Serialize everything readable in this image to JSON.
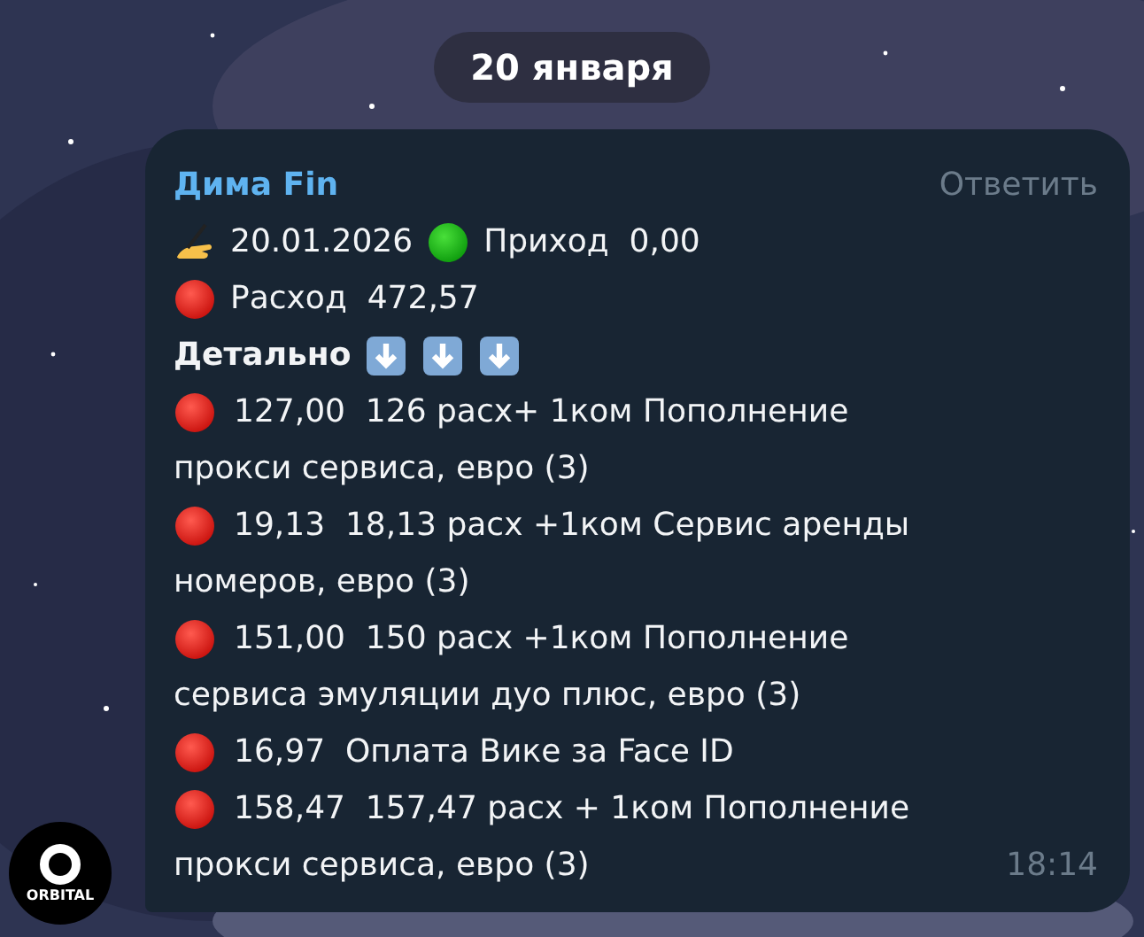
{
  "date_pill": "20 января",
  "message": {
    "sender": "Дима Fin",
    "reply": "Ответить",
    "time": "18:14",
    "summary": [
      [
        {
          "kind": "writing-hand"
        },
        {
          "kind": "text",
          "text": "20.01.2026"
        },
        {
          "kind": "green-dot"
        },
        {
          "kind": "text",
          "text": "Приход  0,00"
        }
      ],
      [
        {
          "kind": "red-dot"
        },
        {
          "kind": "text",
          "text": "Расход  472,57"
        }
      ],
      [
        {
          "kind": "bold",
          "text": "Детально"
        },
        {
          "kind": "down-arrow"
        },
        {
          "kind": "down-arrow"
        },
        {
          "kind": "down-arrow"
        }
      ]
    ],
    "entries": [
      {
        "kind": "red-dot",
        "lines": [
          "127,00  126 расх+ 1ком Пополнение",
          "прокси сервиса, евро (3)"
        ]
      },
      {
        "kind": "red-dot",
        "lines": [
          "19,13  18,13 расх +1ком Сервис аренды",
          "номеров, евро (3)"
        ]
      },
      {
        "kind": "red-dot",
        "lines": [
          "151,00  150 расх +1ком Пополнение",
          "сервиса эмуляции дуо плюс, евро (3)"
        ]
      },
      {
        "kind": "red-dot",
        "lines": [
          "16,97  Оплата Вике за Face ID"
        ]
      },
      {
        "kind": "red-dot",
        "lines": [
          "158,47  157,47 расх + 1ком Пополнение",
          "прокси сервиса, евро (3)"
        ]
      }
    ]
  },
  "avatar": {
    "label": "ORBITAL"
  }
}
